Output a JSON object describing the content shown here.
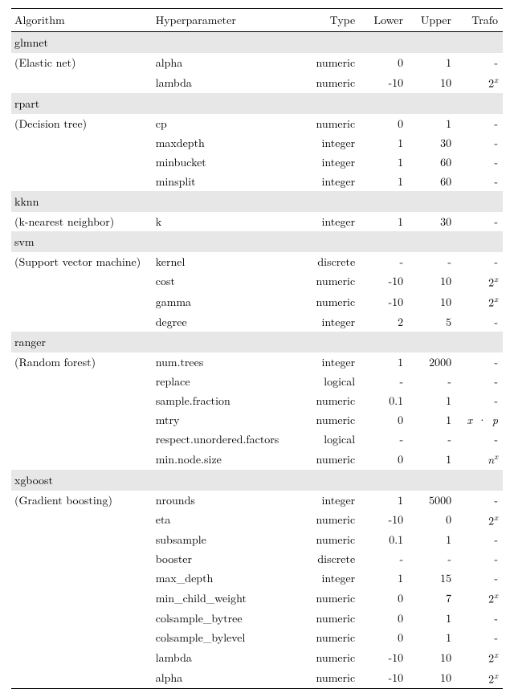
{
  "headers": {
    "algorithm": "Algorithm",
    "hyperparameter": "Hyperparameter",
    "type": "Type",
    "lower": "Lower",
    "upper": "Upper",
    "trafo": "Trafo"
  },
  "chart_data": {
    "type": "table",
    "title": "",
    "columns": [
      "Algorithm",
      "Hyperparameter",
      "Type",
      "Lower",
      "Upper",
      "Trafo"
    ],
    "groups": [
      {
        "algorithm": "glmnet",
        "description": "(Elastic net)",
        "rows": [
          {
            "hyperparameter": "alpha",
            "type": "numeric",
            "lower": "0",
            "upper": "1",
            "trafo": "-"
          },
          {
            "hyperparameter": "lambda",
            "type": "numeric",
            "lower": "-10",
            "upper": "10",
            "trafo": "2^x"
          }
        ]
      },
      {
        "algorithm": "rpart",
        "description": "(Decision tree)",
        "rows": [
          {
            "hyperparameter": "cp",
            "type": "numeric",
            "lower": "0",
            "upper": "1",
            "trafo": "-"
          },
          {
            "hyperparameter": "maxdepth",
            "type": "integer",
            "lower": "1",
            "upper": "30",
            "trafo": "-"
          },
          {
            "hyperparameter": "minbucket",
            "type": "integer",
            "lower": "1",
            "upper": "60",
            "trafo": "-"
          },
          {
            "hyperparameter": "minsplit",
            "type": "integer",
            "lower": "1",
            "upper": "60",
            "trafo": "-"
          }
        ]
      },
      {
        "algorithm": "kknn",
        "description": "(k-nearest neighbor)",
        "rows": [
          {
            "hyperparameter": "k",
            "type": "integer",
            "lower": "1",
            "upper": "30",
            "trafo": "-"
          }
        ]
      },
      {
        "algorithm": "svm",
        "description": "(Support vector machine)",
        "rows": [
          {
            "hyperparameter": "kernel",
            "type": "discrete",
            "lower": "-",
            "upper": "-",
            "trafo": "-"
          },
          {
            "hyperparameter": "cost",
            "type": "numeric",
            "lower": "-10",
            "upper": "10",
            "trafo": "2^x"
          },
          {
            "hyperparameter": "gamma",
            "type": "numeric",
            "lower": "-10",
            "upper": "10",
            "trafo": "2^x"
          },
          {
            "hyperparameter": "degree",
            "type": "integer",
            "lower": "2",
            "upper": "5",
            "trafo": "-"
          }
        ]
      },
      {
        "algorithm": "ranger",
        "description": "(Random forest)",
        "rows": [
          {
            "hyperparameter": "num.trees",
            "type": "integer",
            "lower": "1",
            "upper": "2000",
            "trafo": "-"
          },
          {
            "hyperparameter": "replace",
            "type": "logical",
            "lower": "-",
            "upper": "-",
            "trafo": "-"
          },
          {
            "hyperparameter": "sample.fraction",
            "type": "numeric",
            "lower": "0.1",
            "upper": "1",
            "trafo": "-"
          },
          {
            "hyperparameter": "mtry",
            "type": "numeric",
            "lower": "0",
            "upper": "1",
            "trafo": "x·p"
          },
          {
            "hyperparameter": "respect.unordered.factors",
            "type": "logical",
            "lower": "-",
            "upper": "-",
            "trafo": "-"
          },
          {
            "hyperparameter": "min.node.size",
            "type": "numeric",
            "lower": "0",
            "upper": "1",
            "trafo": "n^x"
          }
        ]
      },
      {
        "algorithm": "xgboost",
        "description": "(Gradient boosting)",
        "rows": [
          {
            "hyperparameter": "nrounds",
            "type": "integer",
            "lower": "1",
            "upper": "5000",
            "trafo": "-"
          },
          {
            "hyperparameter": "eta",
            "type": "numeric",
            "lower": "-10",
            "upper": "0",
            "trafo": "2^x"
          },
          {
            "hyperparameter": "subsample",
            "type": "numeric",
            "lower": "0.1",
            "upper": "1",
            "trafo": "-"
          },
          {
            "hyperparameter": "booster",
            "type": "discrete",
            "lower": "-",
            "upper": "-",
            "trafo": "-"
          },
          {
            "hyperparameter": "max_depth",
            "type": "integer",
            "lower": "1",
            "upper": "15",
            "trafo": "-"
          },
          {
            "hyperparameter": "min_child_weight",
            "type": "numeric",
            "lower": "0",
            "upper": "7",
            "trafo": "2^x"
          },
          {
            "hyperparameter": "colsample_bytree",
            "type": "numeric",
            "lower": "0",
            "upper": "1",
            "trafo": "-"
          },
          {
            "hyperparameter": "colsample_bylevel",
            "type": "numeric",
            "lower": "0",
            "upper": "1",
            "trafo": "-"
          },
          {
            "hyperparameter": "lambda",
            "type": "numeric",
            "lower": "-10",
            "upper": "10",
            "trafo": "2^x"
          },
          {
            "hyperparameter": "alpha",
            "type": "numeric",
            "lower": "-10",
            "upper": "10",
            "trafo": "2^x"
          }
        ]
      }
    ]
  }
}
